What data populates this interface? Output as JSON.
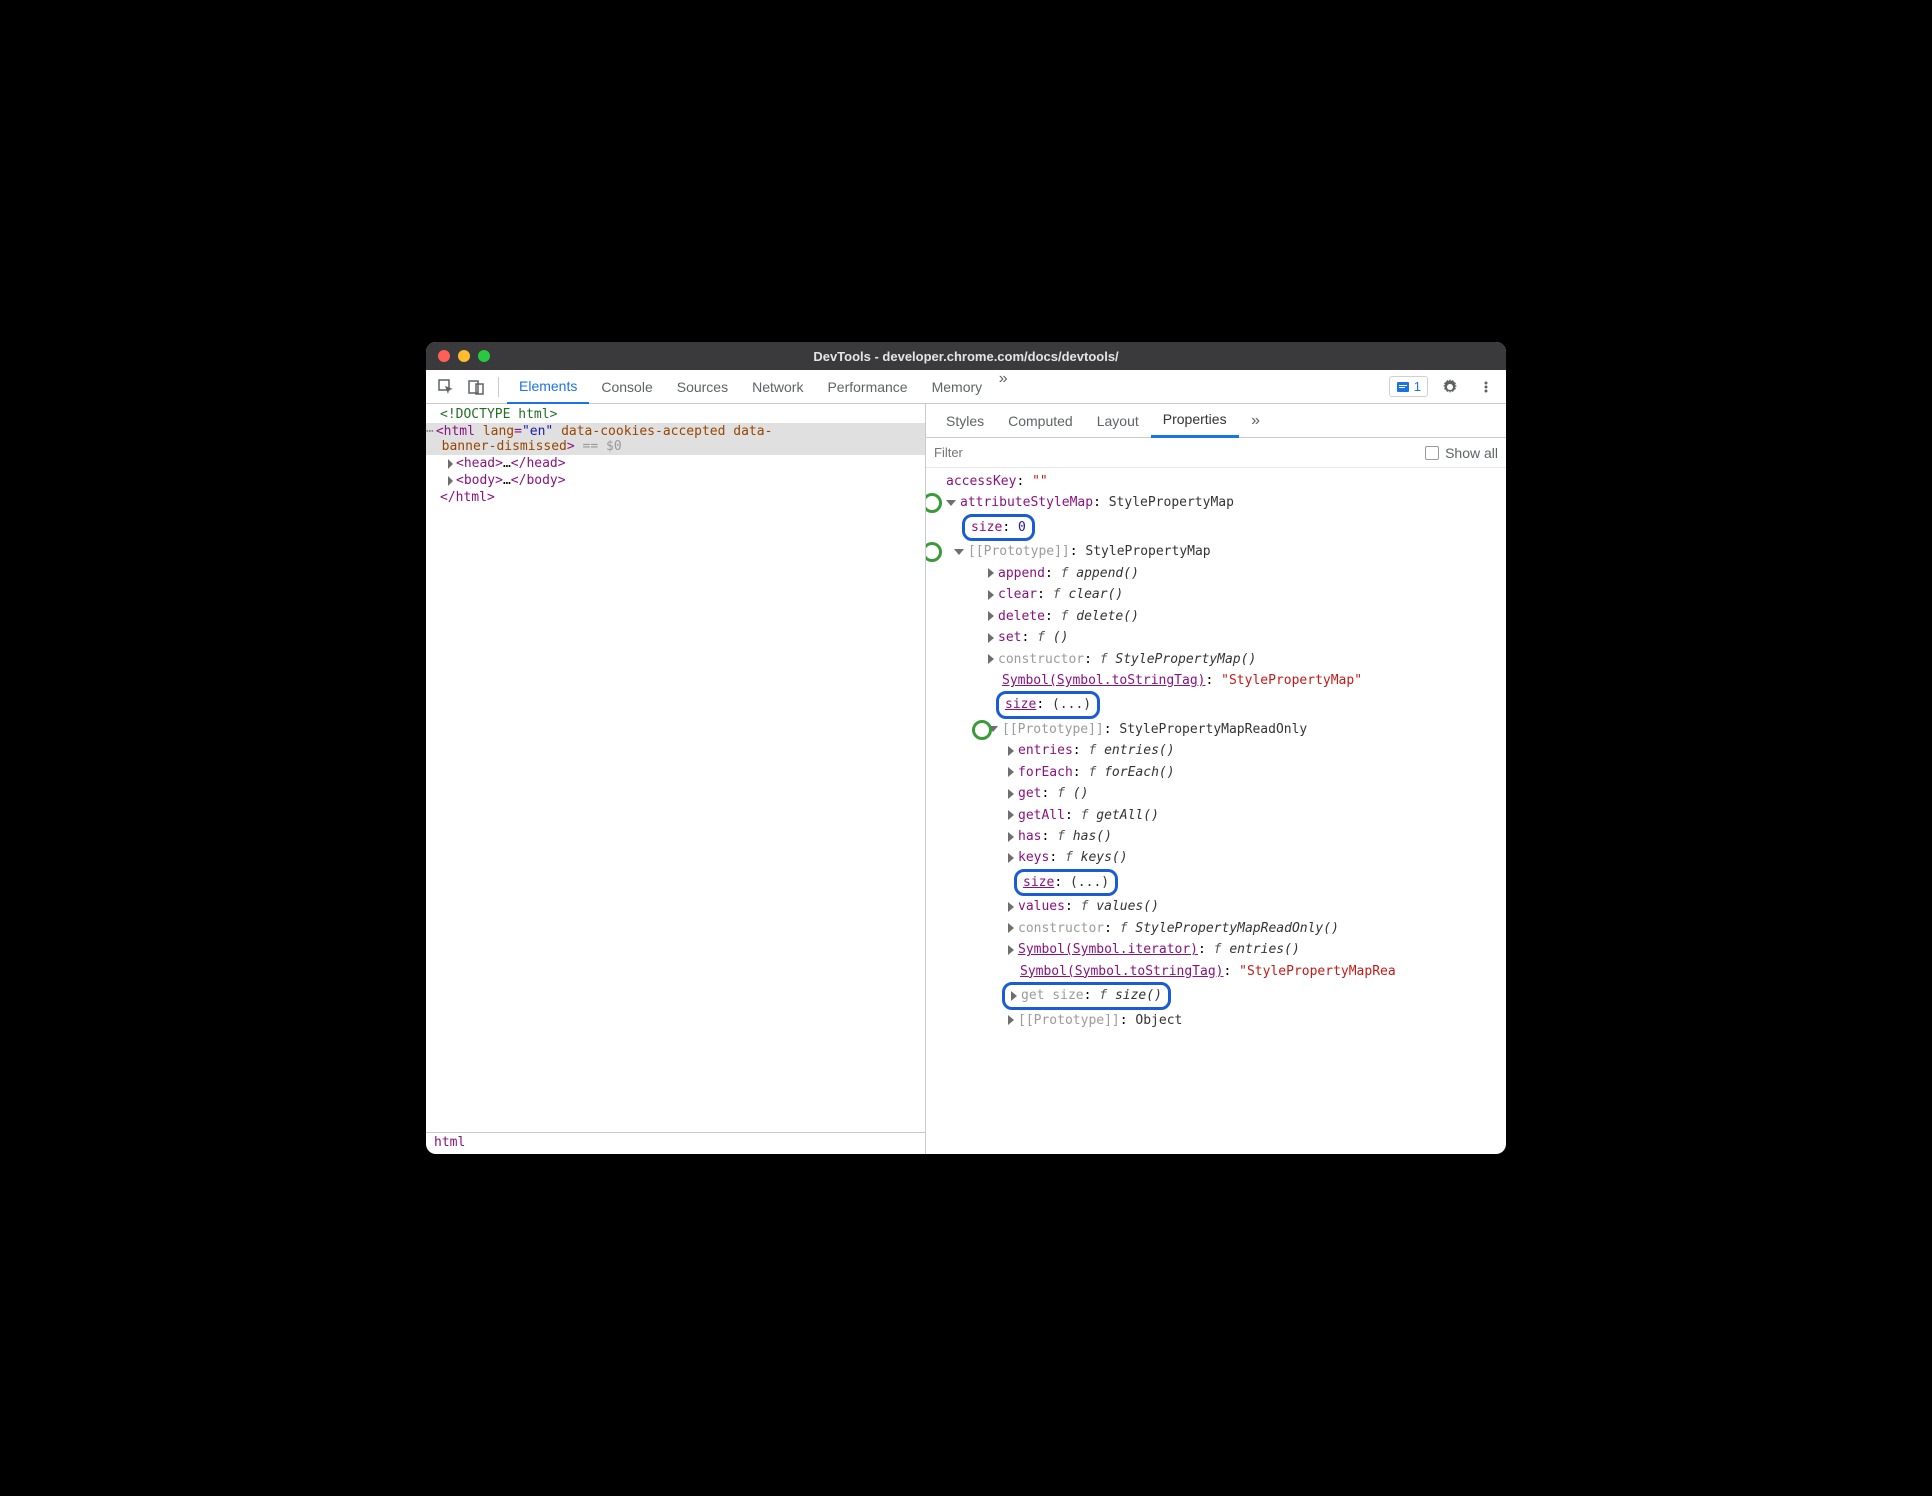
{
  "window": {
    "title": "DevTools - developer.chrome.com/docs/devtools/"
  },
  "toolbar": {
    "tabs": [
      "Elements",
      "Console",
      "Sources",
      "Network",
      "Performance",
      "Memory"
    ],
    "activeTab": "Elements",
    "issueCount": "1"
  },
  "elements": {
    "doctype": "<!DOCTYPE html>",
    "htmlOpen": "<html lang=\"en\" data-cookies-accepted data-banner-dismissed>",
    "eqRef": "== $0",
    "head": "<head>…</head>",
    "body": "<body>…</body>",
    "htmlClose": "</html>",
    "breadcrumb": "html"
  },
  "sidePanel": {
    "tabs": [
      "Styles",
      "Computed",
      "Layout",
      "Properties"
    ],
    "activeTab": "Properties",
    "filterPlaceholder": "Filter",
    "showAllLabel": "Show all"
  },
  "props": {
    "accessKey": {
      "k": "accessKey",
      "v": "\"\""
    },
    "attributeStyleMap": {
      "k": "attributeStyleMap",
      "v": "StylePropertyMap"
    },
    "size0": {
      "k": "size",
      "v": "0"
    },
    "proto1": {
      "k": "[[Prototype]]",
      "v": "StylePropertyMap"
    },
    "append": {
      "k": "append",
      "f": "append()"
    },
    "clear": {
      "k": "clear",
      "f": "clear()"
    },
    "delete": {
      "k": "delete",
      "f": "delete()"
    },
    "set": {
      "k": "set",
      "f": "()"
    },
    "ctor1": {
      "k": "constructor",
      "f": "StylePropertyMap()"
    },
    "symStr1": {
      "k": "Symbol(Symbol.toStringTag)",
      "v": "\"StylePropertyMap\""
    },
    "sizeEllipsis1": {
      "k": "size",
      "v": "(...)"
    },
    "proto2": {
      "k": "[[Prototype]]",
      "v": "StylePropertyMapReadOnly"
    },
    "entries": {
      "k": "entries",
      "f": "entries()"
    },
    "forEach": {
      "k": "forEach",
      "f": "forEach()"
    },
    "get": {
      "k": "get",
      "f": "()"
    },
    "getAll": {
      "k": "getAll",
      "f": "getAll()"
    },
    "has": {
      "k": "has",
      "f": "has()"
    },
    "keys": {
      "k": "keys",
      "f": "keys()"
    },
    "sizeEllipsis2": {
      "k": "size",
      "v": "(...)"
    },
    "values": {
      "k": "values",
      "f": "values()"
    },
    "ctor2": {
      "k": "constructor",
      "f": "StylePropertyMapReadOnly()"
    },
    "symIter": {
      "k": "Symbol(Symbol.iterator)",
      "f": "entries()"
    },
    "symStr2": {
      "k": "Symbol(Symbol.toStringTag)",
      "v": "\"StylePropertyMapRea"
    },
    "getSize": {
      "k": "get size",
      "f": "size()"
    },
    "proto3": {
      "k": "[[Prototype]]",
      "v": "Object"
    }
  }
}
